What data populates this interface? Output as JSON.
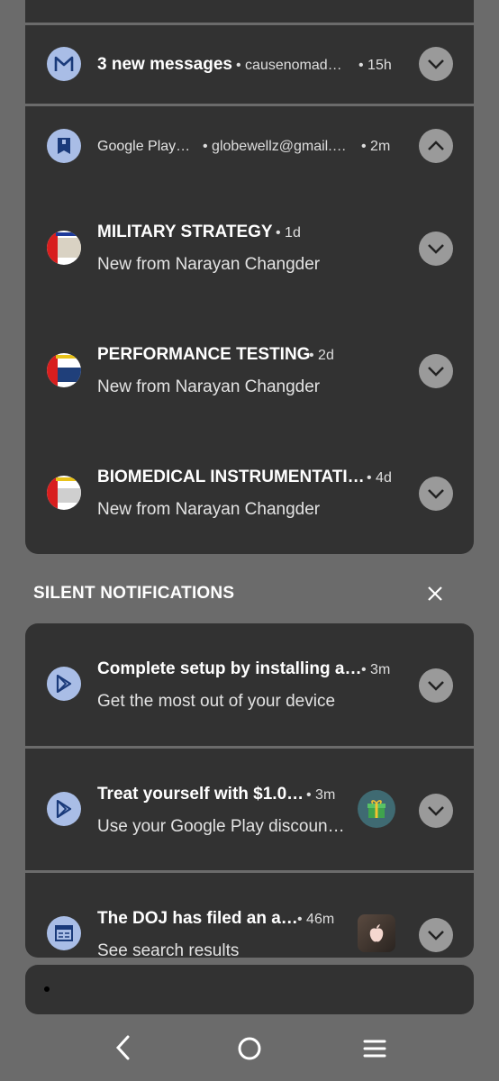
{
  "colors": {
    "background": "#6b6b6b",
    "card": "#323232",
    "icon_bg": "#a9bde6",
    "chevron_bg": "#9a9a9a"
  },
  "notif_messages": {
    "icon": "gmail-icon",
    "title": "3 new messages",
    "sender": "causenomad…",
    "time": "15h",
    "expand": "chevron-down-icon"
  },
  "notif_play_books": {
    "icon": "play-books-icon",
    "app": "Google Play…",
    "account": "globewellz@gmail.…",
    "time": "2m",
    "collapse": "chevron-up-icon",
    "items": [
      {
        "title": "MILITARY STRATEGY",
        "time": "1d",
        "body": "New from Narayan Changder"
      },
      {
        "title": "PERFORMANCE TESTING",
        "time": "2d",
        "body": "New from Narayan Changder"
      },
      {
        "title": "BIOMEDICAL INSTRUMENTATI…",
        "time": "4d",
        "body": "New from Narayan Changder"
      }
    ]
  },
  "silent_section": {
    "label": "SILENT NOTIFICATIONS",
    "close_icon": "close-icon"
  },
  "silent": [
    {
      "icon": "play-store-icon",
      "title": "Complete setup by installing a…",
      "time": "3m",
      "body": "Get the most out of your device"
    },
    {
      "icon": "play-store-icon",
      "title": "Treat yourself with $1.0…",
      "time": "3m",
      "body": "Use your Google Play discoun…",
      "thumb": "gift-icon"
    },
    {
      "icon": "calendar-news-icon",
      "title": "The DOJ has filed an a…",
      "time": "46m",
      "body": "See search results",
      "thumb": "apple-logo-icon"
    }
  ],
  "nav": {
    "back": "back-icon",
    "home": "home-icon",
    "recents": "menu-icon"
  }
}
